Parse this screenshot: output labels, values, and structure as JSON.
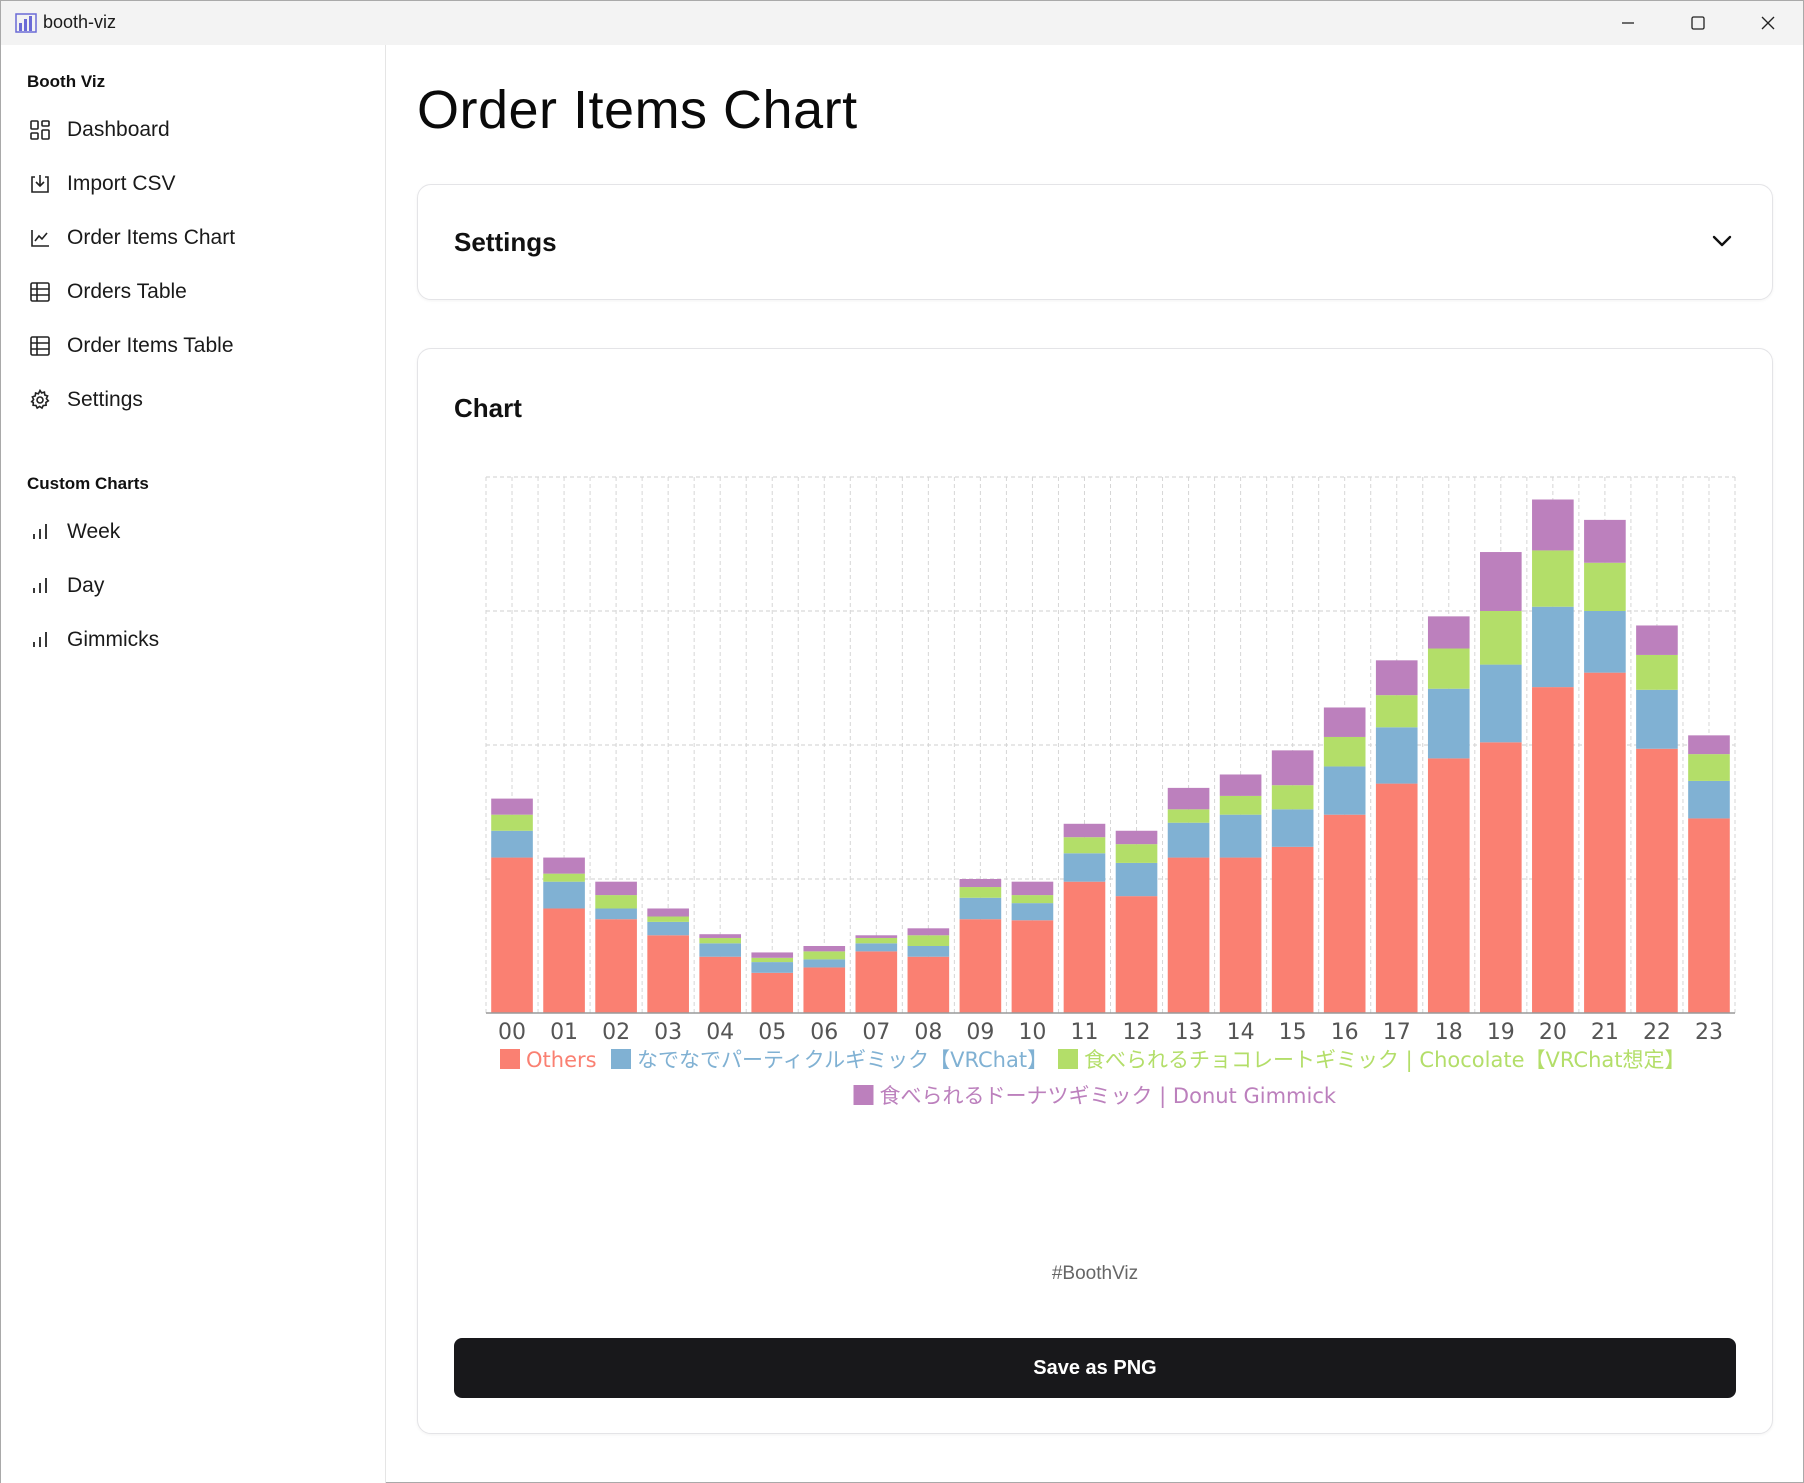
{
  "window": {
    "title": "booth-viz",
    "controls": {
      "minimize": "—",
      "maximize": "☐",
      "close": "✕"
    }
  },
  "sidebar": {
    "group_main": "Booth Viz",
    "items": [
      {
        "label": "Dashboard",
        "icon": "dashboard-icon"
      },
      {
        "label": "Import CSV",
        "icon": "import-icon"
      },
      {
        "label": "Order Items Chart",
        "icon": "line-chart-icon"
      },
      {
        "label": "Orders Table",
        "icon": "table-icon"
      },
      {
        "label": "Order Items Table",
        "icon": "table-icon"
      },
      {
        "label": "Settings",
        "icon": "gear-icon"
      }
    ],
    "group_custom": "Custom Charts",
    "custom_items": [
      {
        "label": "Week",
        "icon": "bar-chart-icon"
      },
      {
        "label": "Day",
        "icon": "bar-chart-icon"
      },
      {
        "label": "Gimmicks",
        "icon": "bar-chart-icon"
      }
    ]
  },
  "main": {
    "page_title": "Order Items Chart",
    "settings_label": "Settings",
    "chart_label": "Chart",
    "hashtag": "#BoothViz",
    "save_label": "Save as PNG"
  },
  "colors": {
    "others": "#fa8072",
    "nadenade": "#80b1d3",
    "chocolate": "#b3de69",
    "donut": "#bc80bd",
    "button_bg": "#18181b"
  },
  "chart_data": {
    "type": "bar",
    "stacked": true,
    "categories": [
      "00",
      "01",
      "02",
      "03",
      "04",
      "05",
      "06",
      "07",
      "08",
      "09",
      "10",
      "11",
      "12",
      "13",
      "14",
      "15",
      "16",
      "17",
      "18",
      "19",
      "20",
      "21",
      "22",
      "23"
    ],
    "ylim": [
      0,
      100
    ],
    "y_gridlines": [
      25,
      50,
      75,
      100
    ],
    "y_tick_labels_shown": false,
    "grid": true,
    "legend_position": "bottom",
    "series": [
      {
        "name": "Others",
        "color": "#fa8072",
        "values": [
          29,
          19.5,
          17.5,
          14.5,
          10.5,
          7.5,
          8.5,
          11.5,
          10.5,
          17.5,
          17.3,
          24.5,
          21.8,
          29,
          29,
          31,
          37,
          42.8,
          47.5,
          50.5,
          60.8,
          63.5,
          49.3,
          36.3
        ]
      },
      {
        "name": "なでなでパーティクルギミック【VRChat】",
        "color": "#80b1d3",
        "values": [
          5,
          5,
          2,
          2.5,
          2.5,
          2,
          1.5,
          1.5,
          2,
          4,
          3.2,
          5.3,
          6.2,
          6.5,
          8,
          7,
          9,
          10.5,
          13,
          14.5,
          15,
          11.5,
          11,
          7
        ]
      },
      {
        "name": "食べられるチョコレートギミック | Chocolate【VRChat想定】",
        "color": "#b3de69",
        "values": [
          3,
          1.5,
          2.5,
          1,
          1,
          0.8,
          1.5,
          1,
          2,
          2,
          1.5,
          3,
          3.5,
          2.5,
          3.5,
          4.5,
          5.5,
          6,
          7.5,
          10,
          10.5,
          9,
          6.5,
          5
        ]
      },
      {
        "name": "食べられるドーナツギミック | Donut Gimmick",
        "color": "#bc80bd",
        "values": [
          3,
          3,
          2.5,
          1.5,
          0.7,
          1,
          1,
          0.5,
          1.3,
          1.5,
          2.5,
          2.5,
          2.5,
          4,
          4,
          6.5,
          5.5,
          6.5,
          6,
          11,
          9.5,
          8,
          5.5,
          3.5
        ]
      }
    ]
  }
}
